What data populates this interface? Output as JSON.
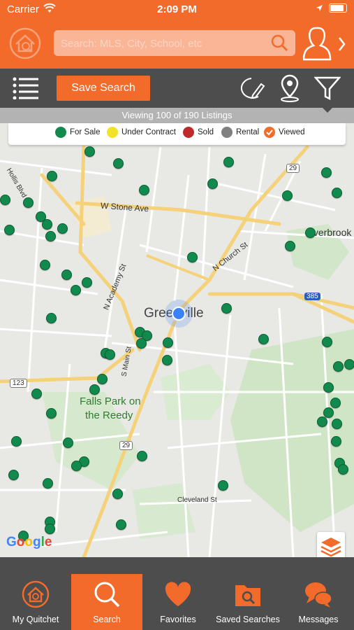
{
  "status": {
    "carrier": "Carrier",
    "time": "2:09 PM"
  },
  "search": {
    "placeholder": "Search: MLS, City, School, etc"
  },
  "toolbar": {
    "save_label": "Save Search"
  },
  "viewing": {
    "text": "Viewing 100 of 190 Listings"
  },
  "legend": [
    {
      "label": "For Sale",
      "color": "#128a4d"
    },
    {
      "label": "Under Contract",
      "color": "#f2e22a"
    },
    {
      "label": "Sold",
      "color": "#c0292b"
    },
    {
      "label": "Rental",
      "color": "#808080"
    },
    {
      "label": "Viewed",
      "color": "#f26b2a"
    }
  ],
  "map": {
    "labels": {
      "city": "Greenville",
      "stone": "W Stone Ave",
      "church": "N Church St",
      "academy": "N Academy St",
      "main": "S Main St",
      "falls1": "Falls Park on",
      "falls2": "the Reedy",
      "cleveland": "Cleveland St",
      "overbrook": "Overbrook",
      "hollis": "Hollis Blvd",
      "r29a": "29",
      "r29b": "29",
      "r123": "123",
      "r385": "385"
    },
    "attribution": "Google"
  },
  "tabs": [
    {
      "label": "My Quitchet"
    },
    {
      "label": "Search"
    },
    {
      "label": "Favorites"
    },
    {
      "label": "Saved Searches"
    },
    {
      "label": "Messages"
    }
  ],
  "colors": {
    "accent": "#f26b2a",
    "bar": "#4d4d4d",
    "pin": "#128a4d"
  }
}
